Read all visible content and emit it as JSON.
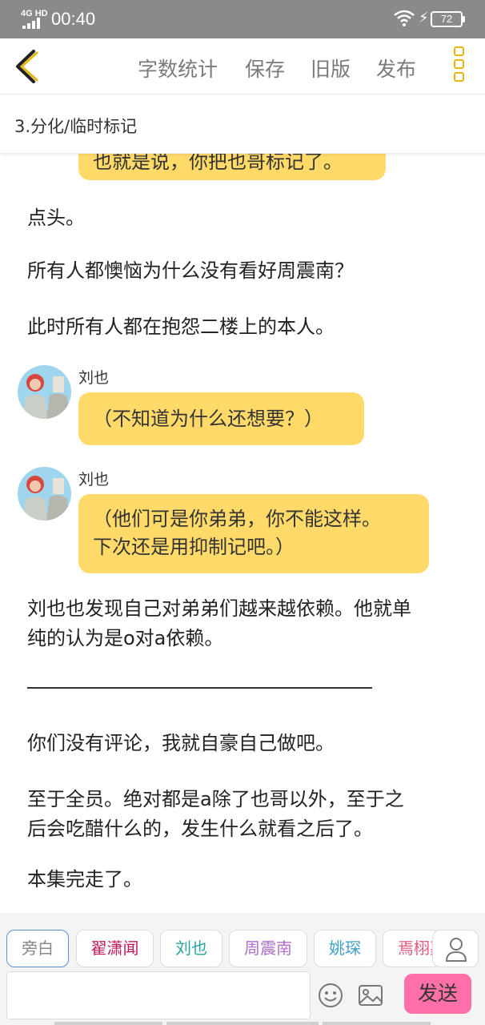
{
  "status_bar": {
    "network": "4G HD",
    "time": "00:40",
    "battery": "72"
  },
  "toolbar": {
    "back_label": "",
    "word_count": "字数统计",
    "save": "保存",
    "old_version": "旧版",
    "publish": "发布"
  },
  "chapter": {
    "title": "3.分化/临时标记"
  },
  "content": {
    "cut_bubble": "也就是说，你把也哥标记了。",
    "p1": "点头。",
    "p2": "所有人都懊恼为什么没有看好周震南？",
    "p3": "此时所有人都在抱怨二楼上的本人。",
    "msg1": {
      "speaker": "刘也",
      "text": "（不知道为什么还想要？）"
    },
    "msg2": {
      "speaker": "刘也",
      "line1": "（他们可是你弟弟，你不能这样。",
      "line2": "下次还是用抑制记吧。）"
    },
    "p4_line1": "刘也也发现自己对弟弟们越来越依赖。他就单",
    "p4_line2": "纯的认为是o对a依赖。",
    "p5": "你们没有评论，我就自豪自己做吧。",
    "p6_line1": "至于全员。绝对都是a除了也哥以外，至于之",
    "p6_line2": "后会吃醋什么的，发生什么就看之后了。",
    "p7": "本集完走了。"
  },
  "characters": [
    {
      "name": "旁白",
      "color": "#888888"
    },
    {
      "name": "翟潇闻",
      "color": "#c2185b"
    },
    {
      "name": "刘也",
      "color": "#26a69a"
    },
    {
      "name": "周震南",
      "color": "#b06ec9"
    },
    {
      "name": "姚琛",
      "color": "#3fa0c4"
    },
    {
      "name": "焉栩嘉",
      "color": "#e05a7a"
    }
  ],
  "composer": {
    "input_value": "",
    "send_label": "发送"
  },
  "colors": {
    "accent_yellow": "#e3b70f",
    "bubble": "#ffda69",
    "send": "#ff6fa8",
    "status_bar": "#8a8a8a"
  },
  "icons": [
    "back-arrow-icon",
    "more-menu-icon",
    "user-icon",
    "emoji-icon",
    "image-icon",
    "wifi-icon",
    "charging-icon"
  ]
}
